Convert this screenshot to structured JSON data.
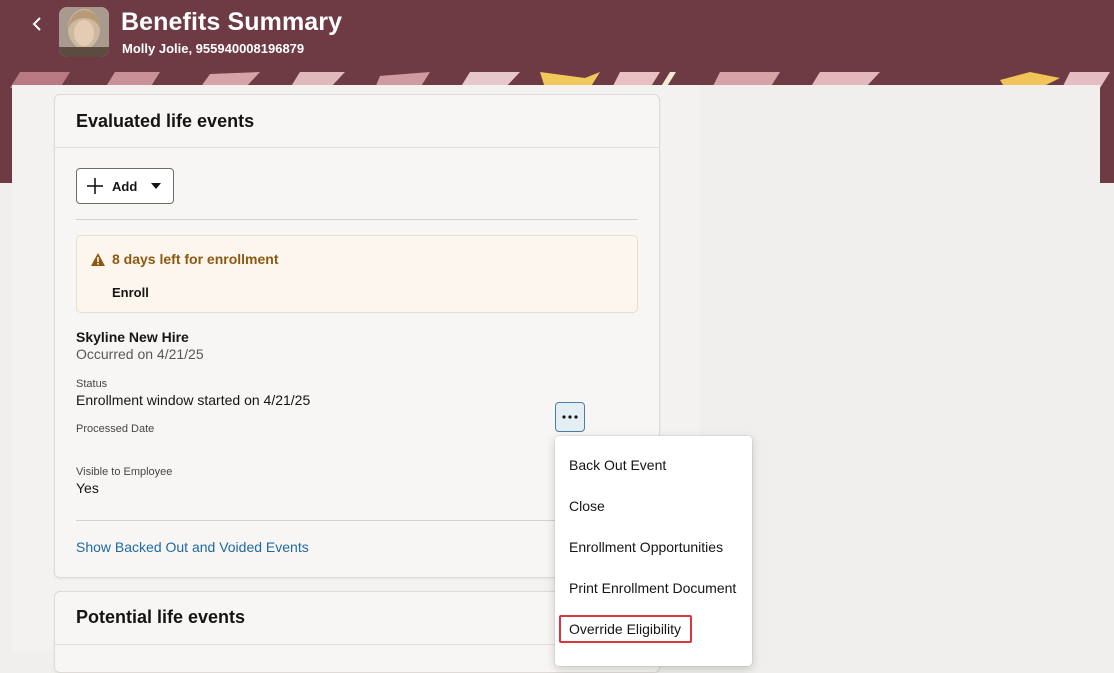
{
  "header": {
    "title": "Benefits Summary",
    "subtitle": "Molly Jolie, 955940008196879"
  },
  "evaluated_card": {
    "title": "Evaluated life events",
    "add_label": "Add",
    "alert": {
      "text": "8 days left for enrollment",
      "action": "Enroll"
    },
    "event": {
      "name": "Skyline New Hire",
      "occurred": "Occurred on 4/21/25",
      "status_label": "Status",
      "status_value": "Enrollment window started on 4/21/25",
      "processed_label": "Processed Date",
      "visible_label": "Visible to Employee",
      "visible_value": "Yes"
    },
    "show_link": "Show Backed Out and Voided Events"
  },
  "potential_card": {
    "title": "Potential life events"
  },
  "menu": {
    "items": [
      "Back Out Event",
      "Close",
      "Enrollment Opportunities",
      "Print Enrollment Document",
      "Override Eligibility"
    ],
    "highlighted": "Override Eligibility"
  },
  "colors": {
    "header_bg": "#6e3b45",
    "warning_text": "#8b5a10",
    "link": "#1f6aa0",
    "highlight_border": "#d9363e"
  },
  "icons": [
    "back-chevron-icon",
    "plus-icon",
    "caret-down-icon",
    "warning-icon",
    "more-options-icon"
  ]
}
